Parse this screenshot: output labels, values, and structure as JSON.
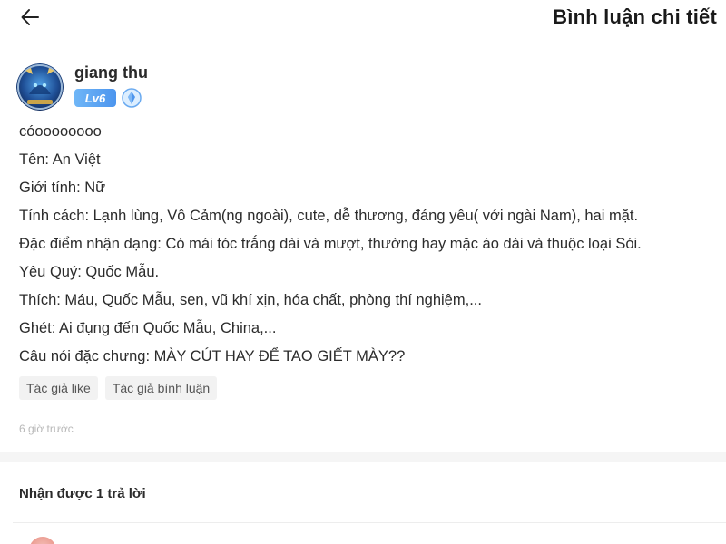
{
  "header": {
    "title": "Bình luận chi tiết",
    "back_icon": "arrow-left-icon"
  },
  "author": {
    "name": "giang thu",
    "level": "Lv6",
    "rank_icon": "crystal-badge-icon"
  },
  "comment": {
    "lines": [
      "cóoooooooo",
      "Tên: An Việt",
      "Giới tính: Nữ",
      "Tính cách: Lạnh lùng, Vô Cảm(ng ngoài), cute, dễ thương, đáng yêu( với ngài Nam), hai mặt.",
      "Đặc điểm nhận dạng: Có mái tóc trắng dài và mượt, thường hay mặc áo dài và thuộc loại Sói.",
      "Yêu Quý: Quốc Mẫu.",
      "Thích: Máu, Quốc Mẫu, sen, vũ khí xịn, hóa chất, phòng thí nghiệm,...",
      "Ghét: Ai đụng đến Quốc Mẫu, China,...",
      "Câu nói đặc chưng: MÀY CÚT HAY ĐỂ TAO GIẾT MÀY??"
    ],
    "tags": [
      "Tác giả like",
      "Tác giả bình luận"
    ],
    "time": "6 giờ trước"
  },
  "replies": {
    "header": "Nhận được 1 trả lời"
  },
  "colors": {
    "level_badge": "#5aa3f2",
    "divider": "#f5f5f5",
    "tag_bg": "#f2f2f2"
  }
}
